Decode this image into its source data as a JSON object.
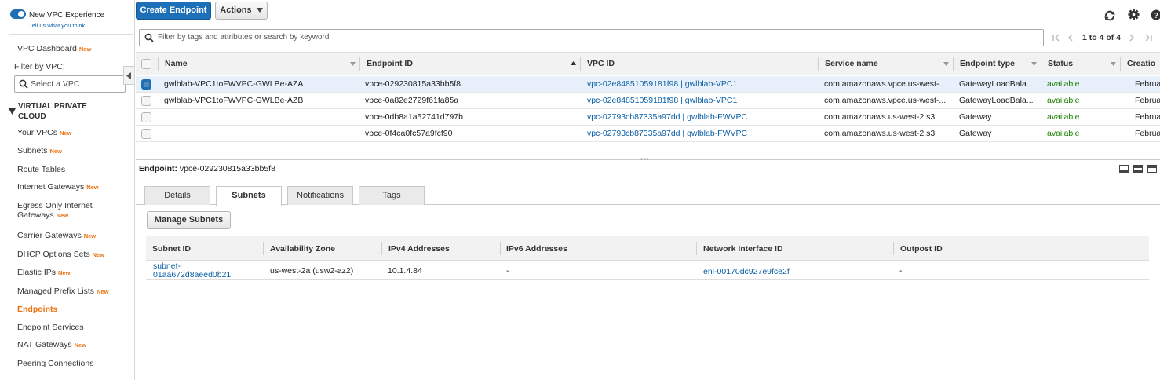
{
  "sidebar": {
    "new_vpc_experience": "New VPC Experience",
    "tell_us": "Tell us what you think",
    "vpc_dashboard": "VPC Dashboard",
    "new_badge": "New",
    "filter_by_vpc": "Filter by VPC:",
    "select_vpc_placeholder": "Select a VPC",
    "section_title_line1": "VIRTUAL PRIVATE",
    "section_title_line2": "CLOUD",
    "items": [
      {
        "label": "Your VPCs",
        "new": "New"
      },
      {
        "label": "Subnets",
        "new": "New"
      },
      {
        "label": "Route Tables",
        "new": ""
      },
      {
        "label": "Internet Gateways",
        "new": "New"
      },
      {
        "label": "Egress Only Internet",
        "label2": "Gateways",
        "new": "New"
      },
      {
        "label": "Carrier Gateways",
        "new": "New"
      },
      {
        "label": "DHCP Options Sets",
        "new": "New"
      },
      {
        "label": "Elastic IPs",
        "new": "New"
      },
      {
        "label": "Managed Prefix Lists",
        "new": "New"
      },
      {
        "label": "Endpoints",
        "new": ""
      },
      {
        "label": "Endpoint Services",
        "new": ""
      },
      {
        "label": "NAT Gateways",
        "new": "New"
      },
      {
        "label": "Peering Connections",
        "new": ""
      }
    ],
    "accent_color": "#ec7211"
  },
  "toolbar": {
    "create_endpoint": "Create Endpoint",
    "actions": "Actions"
  },
  "filter": {
    "placeholder": "Filter by tags and attributes or search by keyword",
    "pagination": "1 to 4 of 4"
  },
  "table": {
    "columns": [
      "Name",
      "Endpoint ID",
      "VPC ID",
      "Service name",
      "Endpoint type",
      "Status",
      "Creatio"
    ],
    "rows": [
      {
        "name": "gwlblab-VPC1toFWVPC-GWLBe-AZA",
        "endpoint_id": "vpce-029230815a33bb5f8",
        "vpc_id": "vpc-02e84851059181f98 | gwlblab-VPC1",
        "service": "com.amazonaws.vpce.us-west-...",
        "type": "GatewayLoadBala...",
        "status": "available",
        "creation": "Februa"
      },
      {
        "name": "gwlblab-VPC1toFWVPC-GWLBe-AZB",
        "endpoint_id": "vpce-0a82e2729f61fa85a",
        "vpc_id": "vpc-02e84851059181f98 | gwlblab-VPC1",
        "service": "com.amazonaws.vpce.us-west-...",
        "type": "GatewayLoadBala...",
        "status": "available",
        "creation": "Februa"
      },
      {
        "name": "",
        "endpoint_id": "vpce-0db8a1a52741d797b",
        "vpc_id": "vpc-02793cb87335a97dd | gwlblab-FWVPC",
        "service": "com.amazonaws.us-west-2.s3",
        "type": "Gateway",
        "status": "available",
        "creation": "Februa"
      },
      {
        "name": "",
        "endpoint_id": "vpce-0f4ca0fc57a9fcf90",
        "vpc_id": "vpc-02793cb87335a97dd | gwlblab-FWVPC",
        "service": "com.amazonaws.us-west-2.s3",
        "type": "Gateway",
        "status": "available",
        "creation": "Februa"
      }
    ],
    "selected_row": 0
  },
  "details": {
    "label": "Endpoint:",
    "endpoint_id": "vpce-029230815a33bb5f8",
    "tabs": [
      "Details",
      "Subnets",
      "Notifications",
      "Tags"
    ],
    "active_tab": "Subnets",
    "manage_subnets": "Manage Subnets",
    "subnet_columns": [
      "Subnet ID",
      "Availability Zone",
      "IPv4 Addresses",
      "IPv6 Addresses",
      "Network Interface ID",
      "Outpost ID"
    ],
    "subnet_row": {
      "subnet_id_line1": "subnet-",
      "subnet_id_line2": "01aa672d8aeed0b21",
      "az": "us-west-2a (usw2-az2)",
      "ipv4": "10.1.4.84",
      "ipv6": "-",
      "eni": "eni-00170dc927e9fce2f",
      "outpost": "-"
    }
  }
}
